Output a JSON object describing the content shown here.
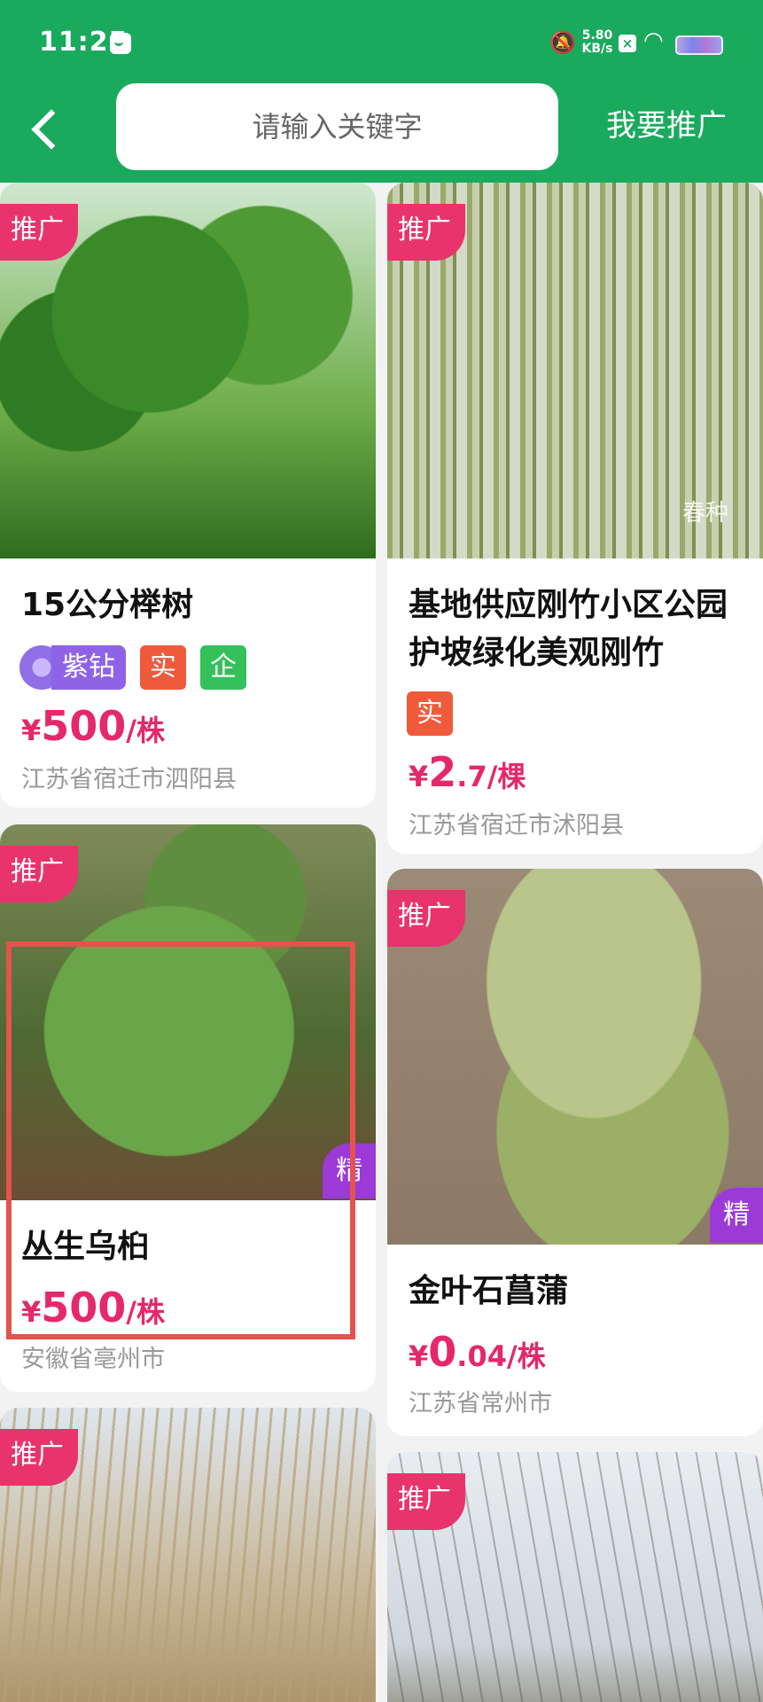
{
  "status_bar": {
    "time": "11:25",
    "speed_value": "5.80",
    "speed_unit": "KB/s"
  },
  "header": {
    "search_placeholder": "请输入关键字",
    "promote_label": "我要推广"
  },
  "badges": {
    "promo": "推广",
    "featured": "精"
  },
  "cards": [
    {
      "title_lines": [
        "15公分榉树"
      ],
      "tags": [
        "紫钻",
        "实",
        "企"
      ],
      "price": {
        "symbol": "¥",
        "int": "500",
        "dec": "",
        "unit": "/株"
      },
      "location": "江苏省宿迁市泗阳县",
      "promoted": true,
      "featured": false
    },
    {
      "title_lines": [
        "基地供应刚竹小区公园",
        "护坡绿化美观刚竹"
      ],
      "tags": [
        "实"
      ],
      "price": {
        "symbol": "¥",
        "int": "2",
        "dec": ".7",
        "unit": "/棵"
      },
      "location": "江苏省宿迁市沭阳县",
      "promoted": true,
      "featured": false,
      "watermark": "春种"
    },
    {
      "title_lines": [
        "丛生乌桕"
      ],
      "tags": [],
      "price": {
        "symbol": "¥",
        "int": "500",
        "dec": "",
        "unit": "/株"
      },
      "location": "安徽省亳州市",
      "promoted": true,
      "featured": true
    },
    {
      "title_lines": [
        "金叶石菖蒲"
      ],
      "tags": [],
      "price": {
        "symbol": "¥",
        "int": "0",
        "dec": ".04",
        "unit": "/株"
      },
      "location": "江苏省常州市",
      "promoted": true,
      "featured": true
    },
    {
      "title_lines": [],
      "promoted": true
    },
    {
      "title_lines": [],
      "promoted": true
    }
  ],
  "colors": {
    "header_green": "#1aaa5e",
    "promo_pink": "#e8336d",
    "price_red": "#e4286b",
    "featured_purple": "#9b3ad6",
    "highlight_red": "#e4534e"
  }
}
